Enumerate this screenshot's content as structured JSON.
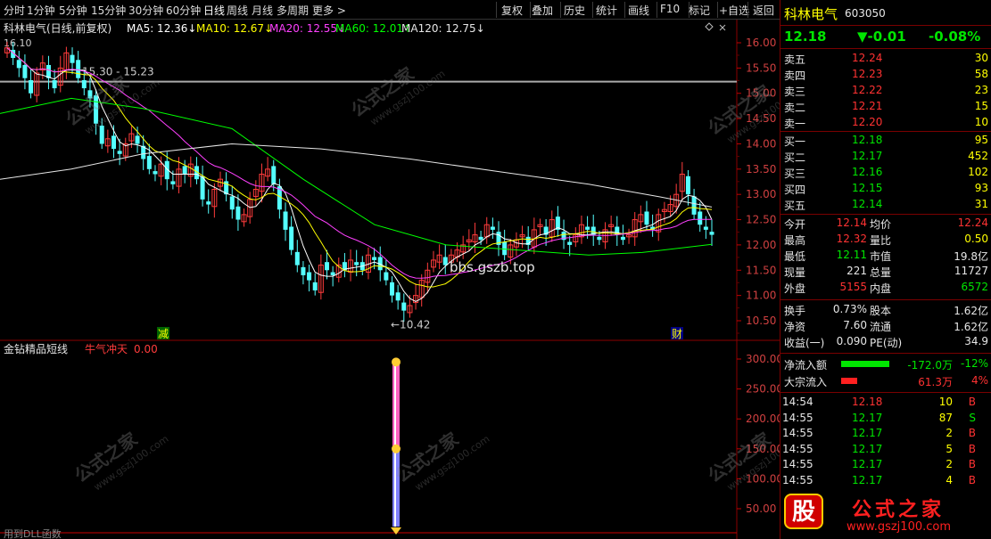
{
  "toolbar": {
    "left": [
      "分时",
      "1分钟",
      "5分钟",
      "15分钟",
      "30分钟",
      "60分钟",
      "日线",
      "周线",
      "月线",
      "多周期",
      "更多 >"
    ],
    "right": [
      "复权",
      "叠加",
      "历史",
      "统计",
      "画线",
      "F10",
      "标记",
      "+自选",
      "返回"
    ]
  },
  "main": {
    "stock_label": "科林电气(日线,前复权)",
    "ma": [
      {
        "label": "MA5: 12.36↓",
        "color": "#ffffff"
      },
      {
        "label": "MA10: 12.67↓",
        "color": "#ffff00"
      },
      {
        "label": "MA20: 12.55↓",
        "color": "#ff40ff"
      },
      {
        "label": "MA60: 12.01↑",
        "color": "#00ff00"
      },
      {
        "label": "MA120: 12.75↓",
        "color": "#e6e6e6"
      }
    ],
    "hi_marker": "16.10",
    "annotation_top": "15.30 - 15.23",
    "annotation_low": "←10.42",
    "watermark_url": "bbs.gszb.top",
    "marker_jian": "减",
    "marker_cai": "财",
    "yaxis": [
      "16.00",
      "15.50",
      "15.00",
      "14.50",
      "14.00",
      "13.50",
      "13.00",
      "12.50",
      "12.00",
      "11.50",
      "11.00",
      "10.50"
    ]
  },
  "indicator": {
    "title": "金钻精品短线",
    "tag": "牛气冲天",
    "value": "0.00",
    "yaxis": [
      "300.00",
      "250.00",
      "200.00",
      "150.00",
      "100.00",
      "50.00"
    ],
    "footer": "用到DLL函数"
  },
  "watermark": {
    "cn": "公式之家",
    "url": "www.gszj100.com",
    "logo_char": "股",
    "logo_text": "公式之家",
    "logo_url": "www.gszj100.com"
  },
  "quote": {
    "name": "科林电气",
    "code": "603050",
    "price": "12.18",
    "change": "▼-0.01",
    "pct": "-0.08%",
    "sell": [
      {
        "label": "卖五",
        "price": "12.24",
        "vol": "30"
      },
      {
        "label": "卖四",
        "price": "12.23",
        "vol": "58"
      },
      {
        "label": "卖三",
        "price": "12.22",
        "vol": "23"
      },
      {
        "label": "卖二",
        "price": "12.21",
        "vol": "15"
      },
      {
        "label": "卖一",
        "price": "12.20",
        "vol": "10"
      }
    ],
    "buy": [
      {
        "label": "买一",
        "price": "12.18",
        "vol": "95"
      },
      {
        "label": "买二",
        "price": "12.17",
        "vol": "452"
      },
      {
        "label": "买三",
        "price": "12.16",
        "vol": "102"
      },
      {
        "label": "买四",
        "price": "12.15",
        "vol": "93"
      },
      {
        "label": "买五",
        "price": "12.14",
        "vol": "31"
      }
    ],
    "stats": [
      {
        "l1": "今开",
        "v1": "12.14",
        "c1": "red",
        "l2": "均价",
        "v2": "12.24",
        "c2": "red"
      },
      {
        "l1": "最高",
        "v1": "12.32",
        "c1": "red",
        "l2": "量比",
        "v2": "0.50",
        "c2": "yellow"
      },
      {
        "l1": "最低",
        "v1": "12.11",
        "c1": "green",
        "l2": "市值",
        "v2": "19.8亿",
        "c2": "white"
      },
      {
        "l1": "现量",
        "v1": "221",
        "c1": "white",
        "l2": "总量",
        "v2": "11727",
        "c2": "white"
      },
      {
        "l1": "外盘",
        "v1": "5155",
        "c1": "red",
        "l2": "内盘",
        "v2": "6572",
        "c2": "green"
      }
    ],
    "stats2": [
      {
        "l1": "换手",
        "v1": "0.73%",
        "l2": "股本",
        "v2": "1.62亿"
      },
      {
        "l1": "净资",
        "v1": "7.60",
        "l2": "流通",
        "v2": "1.62亿"
      },
      {
        "l1": "收益(一)",
        "v1": "0.090",
        "l2": "PE(动)",
        "v2": "34.9"
      }
    ],
    "flow": [
      {
        "label": "净流入额",
        "value": "-172.0万",
        "pct": "-12%",
        "bar_color": "#00e600",
        "fill": 0.75,
        "vcls": "green",
        "pcls": "green"
      },
      {
        "label": "大宗流入",
        "value": "61.3万",
        "pct": "4%",
        "bar_color": "#ff2020",
        "fill": 0.25,
        "vcls": "red",
        "pcls": "red"
      }
    ],
    "ticks": [
      {
        "time": "14:54",
        "price": "12.18",
        "vol": "10",
        "side": "B",
        "pc": "red",
        "sc": "red"
      },
      {
        "time": "14:55",
        "price": "12.17",
        "vol": "87",
        "side": "S",
        "pc": "green",
        "sc": "green"
      },
      {
        "time": "14:55",
        "price": "12.17",
        "vol": "2",
        "side": "B",
        "pc": "green",
        "sc": "red"
      },
      {
        "time": "14:55",
        "price": "12.17",
        "vol": "5",
        "side": "B",
        "pc": "green",
        "sc": "red"
      },
      {
        "time": "14:55",
        "price": "12.17",
        "vol": "2",
        "side": "B",
        "pc": "green",
        "sc": "red"
      },
      {
        "time": "14:55",
        "price": "12.17",
        "vol": "4",
        "side": "B",
        "pc": "green",
        "sc": "red"
      }
    ]
  }
}
